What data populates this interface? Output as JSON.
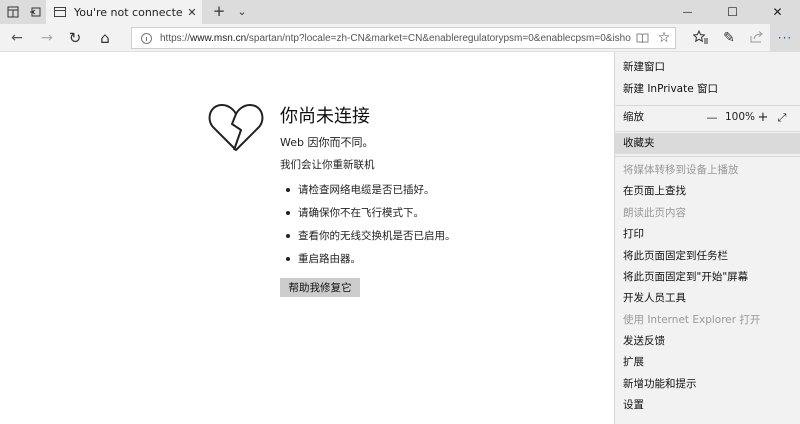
{
  "titlebar": {
    "tab_title": "You're not connected",
    "close_glyph": "✕",
    "newtab_glyph": "+",
    "tabmenu_glyph": "⌄",
    "minimize_glyph": "—",
    "maximize_glyph": "☐",
    "close_window_glyph": "✕"
  },
  "navbar": {
    "back_glyph": "←",
    "forward_glyph": "→",
    "refresh_glyph": "↻",
    "home_glyph": "⌂",
    "url_prefix": "https://",
    "url_host": "www.msn.cn",
    "url_rest": "/spartan/ntp?locale=zh-CN&market=CN&enableregulatorypsm=0&enablecpsm=0&ishostisolationenforc",
    "reading_glyph": "📖",
    "favorite_glyph": "☆",
    "hub_glyph": "☆≡",
    "notes_glyph": "✎",
    "share_glyph": "⇪",
    "more_glyph": "···"
  },
  "page": {
    "title": "你尚未连接",
    "subtitle": "Web 因你而不同。",
    "try_text": "我们会让你重新联机",
    "tips": [
      "请检查网络电缆是否已插好。",
      "请确保你不在飞行模式下。",
      "查看你的无线交换机是否已启用。",
      "重启路由器。"
    ],
    "fix_button": "帮助我修复它"
  },
  "menu": {
    "new_window": "新建窗口",
    "new_inprivate": "新建 InPrivate 窗口",
    "zoom_label": "缩放",
    "zoom_minus": "—",
    "zoom_value": "100%",
    "zoom_plus": "+",
    "zoom_fullscreen": "⤢",
    "favorites": "收藏夹",
    "cast": "将媒体转移到设备上播放",
    "find": "在页面上查找",
    "read_aloud": "朗读此页内容",
    "print": "打印",
    "pin_taskbar": "将此页面固定到任务栏",
    "pin_start": "将此页面固定到\"开始\"屏幕",
    "dev_tools": "开发人员工具",
    "open_ie": "使用 Internet Explorer 打开",
    "feedback": "发送反馈",
    "extensions": "扩展",
    "whats_new": "新增功能和提示",
    "settings": "设置"
  }
}
